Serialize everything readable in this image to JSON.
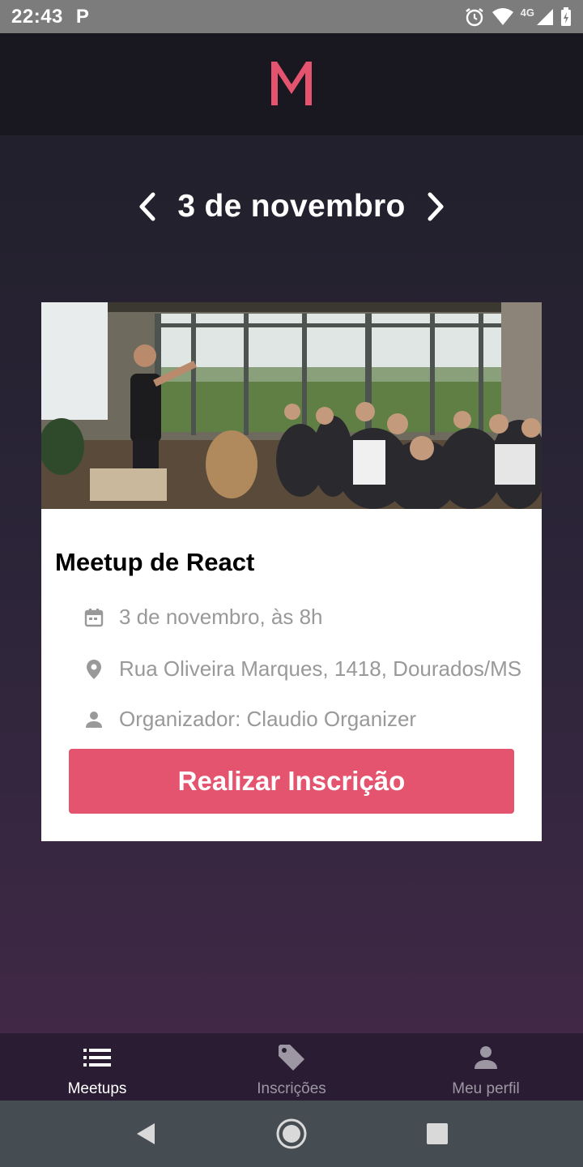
{
  "status_bar": {
    "time": "22:43",
    "notification": "P",
    "network": "4G"
  },
  "header": {
    "logo": "M",
    "accent_color": "#e5546e"
  },
  "date_nav": {
    "title": "3 de novembro",
    "prev_icon": "chevron-left-icon",
    "next_icon": "chevron-right-icon"
  },
  "meetup": {
    "title": "Meetup de React",
    "image": "photo of presenter speaking to an audience in a room with large windows",
    "date": "3 de novembro, às  8h",
    "location": "Rua Oliveira Marques, 1418, Dourados/MS",
    "organizer": "Organizador: Claudio Organizer",
    "button_label": "Realizar Inscrição"
  },
  "tabs": [
    {
      "label": "Meetups",
      "icon": "list-icon",
      "active": true
    },
    {
      "label": "Inscrições",
      "icon": "tag-icon",
      "active": false
    },
    {
      "label": "Meu perfil",
      "icon": "person-icon",
      "active": false
    }
  ]
}
